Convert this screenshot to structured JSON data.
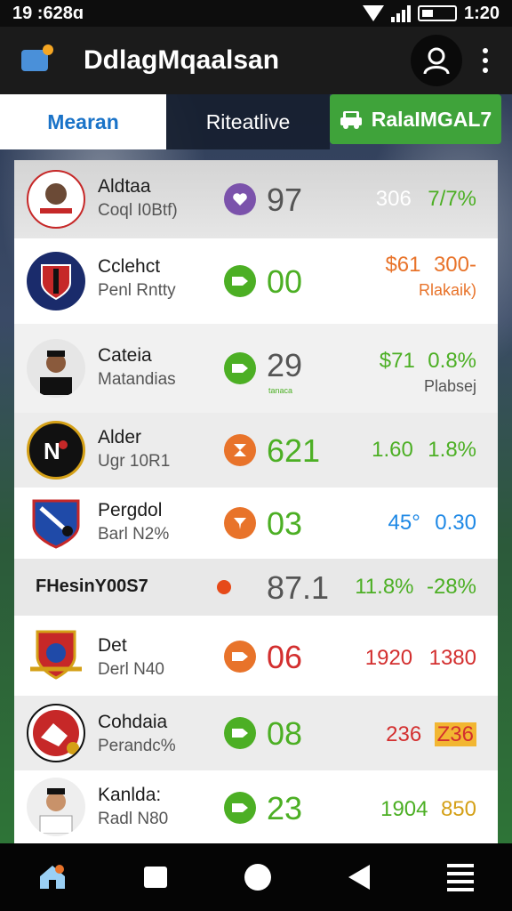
{
  "status_bar": {
    "left_text": "19 :628ɑ",
    "time": "1:20"
  },
  "app_bar": {
    "title": "DdlagMqaalsan"
  },
  "tabs": [
    {
      "label": "Mearan"
    },
    {
      "label": "Riteatlive"
    },
    {
      "label": "RalaIMGAL7"
    }
  ],
  "colors": {
    "tab_active_text": "#1a73c8",
    "tab_green": "#3fa33a",
    "green": "#4caf24",
    "orange": "#e8732a",
    "red": "#d32f2f",
    "purple": "#7b52ab"
  },
  "rows": [
    {
      "name": "Aldtaa",
      "sub": "Coql I0Btf)",
      "status": "purple",
      "score": "97",
      "right_main_a": "306",
      "right_main_b": "7/7%",
      "right_sub": ""
    },
    {
      "name": "Cclehct",
      "sub": "Penl Rntty",
      "status": "green",
      "score": "00",
      "right_main_a": "$61",
      "right_main_b": "300-",
      "right_sub": "Rlakaik)"
    },
    {
      "name": "Cateia",
      "sub": "Matandias",
      "status": "green",
      "score": "29",
      "score_note": "tanaca",
      "right_main_a": "$71",
      "right_main_b": "0.8%",
      "right_sub": "Plabsej"
    },
    {
      "name": "Alder",
      "sub": "Ugr 10R1",
      "status": "orange",
      "score": "621",
      "right_main_a": "1.60",
      "right_main_b": "1.8%",
      "right_sub": ""
    },
    {
      "name": "Pergdol",
      "sub": "Barl N2%",
      "status": "orange",
      "score": "03",
      "right_main_a": "45°",
      "right_main_b": "0.30",
      "right_sub": ""
    },
    {
      "name": "FHesinY00S7",
      "sub": "",
      "status": "red-small",
      "score": "87.1",
      "right_main_a": "11.8%",
      "right_main_b": "-28%",
      "right_sub": ""
    },
    {
      "name": "Det",
      "sub": "Derl N40",
      "status": "orange",
      "score": "06",
      "right_main_a": "1920",
      "right_main_b": "1380",
      "right_sub": ""
    },
    {
      "name": "Cohdaia",
      "sub": "Perandc%",
      "status": "green",
      "score": "08",
      "right_main_a": "236",
      "right_main_b": "Z36",
      "right_sub": ""
    },
    {
      "name": "Kanlda:",
      "sub": "Radl N80",
      "status": "green",
      "score": "23",
      "right_main_a": "1904",
      "right_main_b": "850",
      "right_sub": ""
    }
  ],
  "nav": {
    "items": [
      "home-icon",
      "square-icon",
      "circle-icon",
      "back-icon",
      "menu-icon"
    ]
  }
}
